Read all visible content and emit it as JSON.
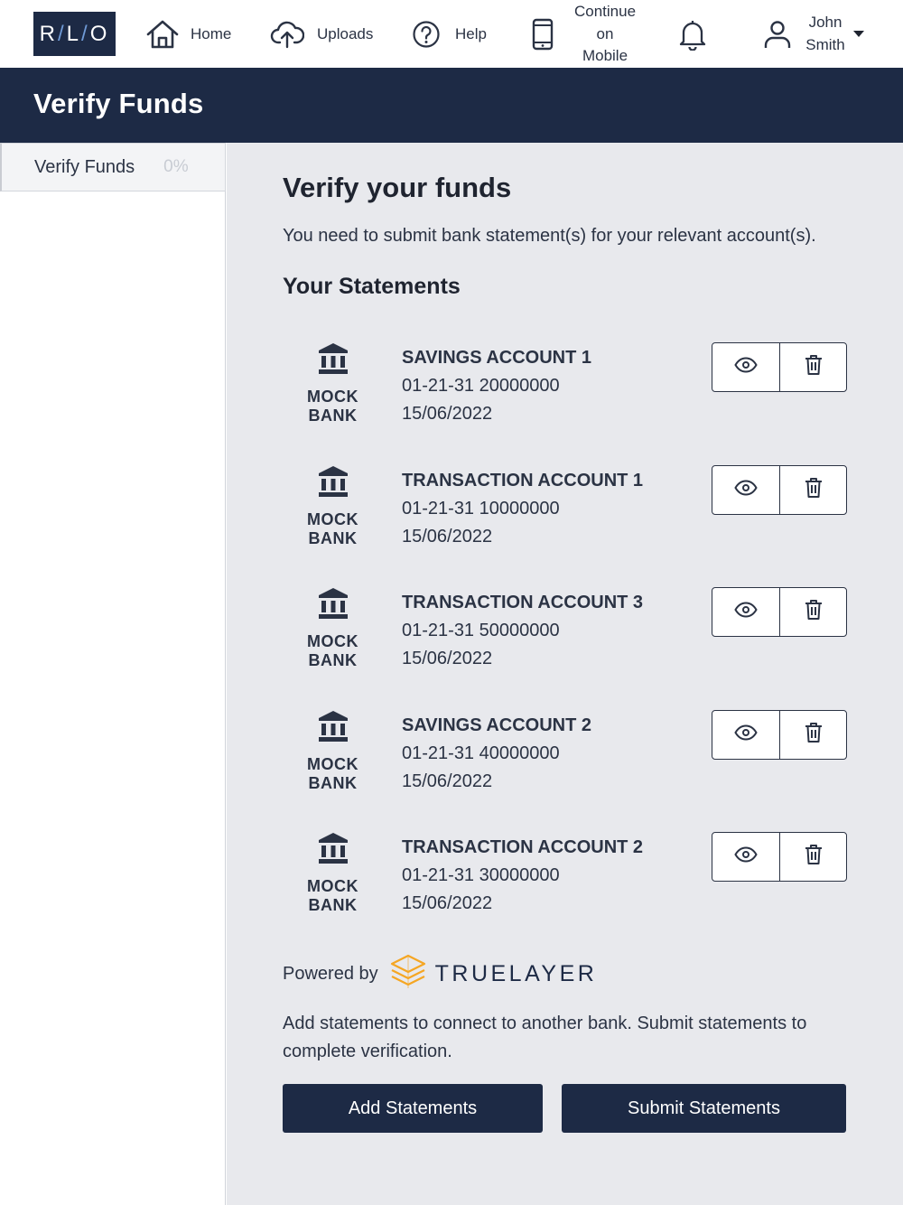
{
  "logo": {
    "text_r": "R",
    "sep1": "/",
    "text_l": "L",
    "sep2": "/",
    "text_o": "O"
  },
  "nav": {
    "home": "Home",
    "uploads": "Uploads",
    "help": "Help",
    "mobile": "Continue\non\nMobile",
    "user": "John\nSmith"
  },
  "header": {
    "title": "Verify Funds"
  },
  "sidebar": {
    "items": [
      {
        "label": "Verify Funds",
        "progress": "0%"
      }
    ]
  },
  "main": {
    "title": "Verify your funds",
    "intro": "You need to submit bank statement(s) for your relevant account(s).",
    "statements_heading": "Your Statements",
    "statements": [
      {
        "bank": "MOCK BANK",
        "account": "SAVINGS ACCOUNT 1",
        "number": "01-21-31 20000000",
        "date": "15/06/2022"
      },
      {
        "bank": "MOCK BANK",
        "account": "TRANSACTION ACCOUNT 1",
        "number": "01-21-31 10000000",
        "date": "15/06/2022"
      },
      {
        "bank": "MOCK BANK",
        "account": "TRANSACTION ACCOUNT 3",
        "number": "01-21-31 50000000",
        "date": "15/06/2022"
      },
      {
        "bank": "MOCK BANK",
        "account": "SAVINGS ACCOUNT 2",
        "number": "01-21-31 40000000",
        "date": "15/06/2022"
      },
      {
        "bank": "MOCK BANK",
        "account": "TRANSACTION ACCOUNT 2",
        "number": "01-21-31 30000000",
        "date": "15/06/2022"
      }
    ],
    "powered_by": "Powered by",
    "provider": "TRUELAYER",
    "note": "Add statements to connect to another bank. Submit statements to complete verification.",
    "add_button": "Add Statements",
    "submit_button": "Submit Statements"
  },
  "colors": {
    "navy": "#1d2a45",
    "background": "#e8e9ed",
    "truelayer_orange": "#f5a623"
  },
  "icons": [
    "home-icon",
    "upload-cloud-icon",
    "help-icon",
    "mobile-phone-icon",
    "bell-icon",
    "user-icon",
    "bank-icon",
    "eye-icon",
    "trash-icon",
    "truelayer-logo-icon"
  ]
}
